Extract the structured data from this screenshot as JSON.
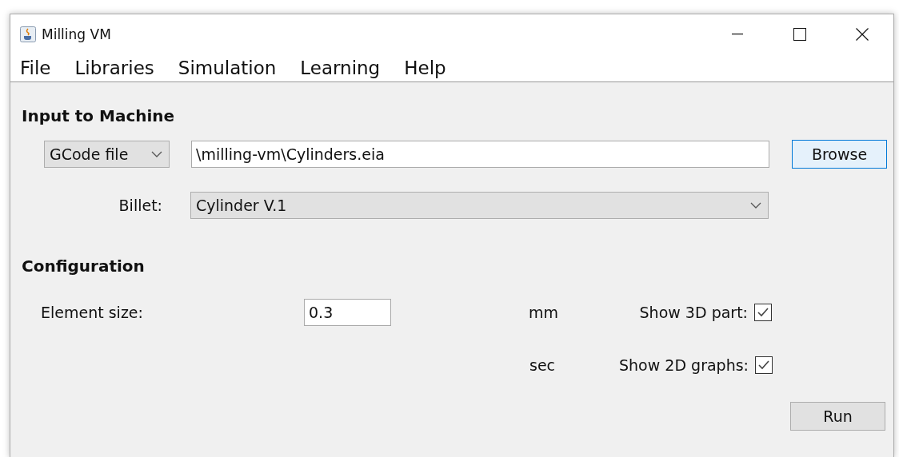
{
  "window": {
    "title": "Milling VM"
  },
  "menu": [
    "File",
    "Libraries",
    "Simulation",
    "Learning",
    "Help"
  ],
  "input_section": {
    "heading": "Input to Machine",
    "source": {
      "value": "GCode file"
    },
    "file_path": {
      "value": "\\milling-vm\\Cylinders.eia"
    },
    "browse_button": "Browse",
    "billet_label": "Billet:",
    "billet": {
      "value": "Cylinder V.1"
    }
  },
  "configuration": {
    "heading": "Configuration",
    "element_size_label": "Element size:",
    "element_size": {
      "value": "0.3"
    },
    "units": [
      "mm",
      "sec"
    ],
    "options": [
      {
        "label": "Show 3D part:",
        "checked": true
      },
      {
        "label": "Show 2D graphs:",
        "checked": true
      }
    ]
  },
  "run_button": "Run"
}
